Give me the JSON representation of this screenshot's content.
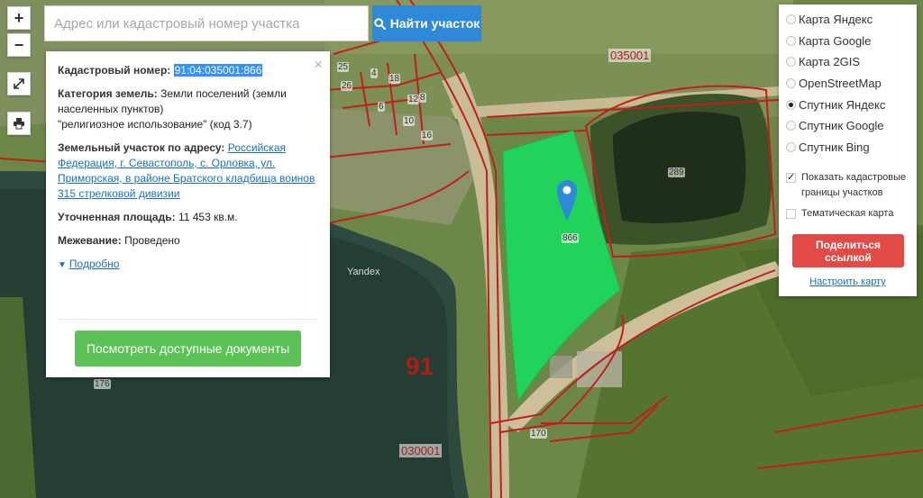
{
  "search": {
    "placeholder": "Адрес или кадастровый номер участка",
    "button_label": "Найти участок"
  },
  "tools": {
    "zoom_in": "+",
    "zoom_out": "−"
  },
  "info": {
    "close": "×",
    "cadastral_label": "Кадастровый номер:",
    "cadastral_value": "91:04:035001:866",
    "category_label": "Категория земель:",
    "category_value": "Земли поселений (земли населенных пунктов)",
    "usage_value": "\"религиозное использование\" (код 3.7)",
    "address_label": "Земельный участок по адресу:",
    "address_value": "Российская Федерация, г. Севастополь, с. Орловка, ул. Приморская, в районе Братского кладбища воинов 315 стрелковой дивизии",
    "area_label": "Уточненная площадь:",
    "area_value": "11 453 кв.м.",
    "survey_label": "Межевание:",
    "survey_value": "Проведено",
    "more_link": "Подробно",
    "documents_button": "Посмотреть доступные документы"
  },
  "layers": {
    "options": [
      {
        "label": "Карта Яндекс",
        "selected": false
      },
      {
        "label": "Карта Google",
        "selected": false
      },
      {
        "label": "Карта 2GIS",
        "selected": false
      },
      {
        "label": "OpenStreetMap",
        "selected": false
      },
      {
        "label": "Спутник Яндекс",
        "selected": true
      },
      {
        "label": "Спутник Google",
        "selected": false
      },
      {
        "label": "Спутник Bing",
        "selected": false
      }
    ],
    "show_boundaries": {
      "label": "Показать кадастровые границы участков",
      "checked": true
    },
    "thematic": {
      "label": "Тематическая карта",
      "checked": false
    },
    "share_button": "Поделиться ссылкой",
    "configure_link": "Настроить карту"
  },
  "map": {
    "quarter_top": "035001",
    "quarter_bottom": "030001",
    "region": "91",
    "plot_selected": "866",
    "plot_289": "289",
    "plot_170": "170",
    "plot_176": "176",
    "plots_small": [
      "25",
      "26",
      "4",
      "18",
      "6",
      "10",
      "8",
      "12",
      "16"
    ],
    "watermark": "Yandex",
    "highlight_color": "#21d35a",
    "boundary_color": "#c21e1e"
  },
  "icons": {
    "search": "search-icon",
    "fullscreen": "fullscreen-icon",
    "print": "printer-icon",
    "marker": "map-marker-icon"
  }
}
